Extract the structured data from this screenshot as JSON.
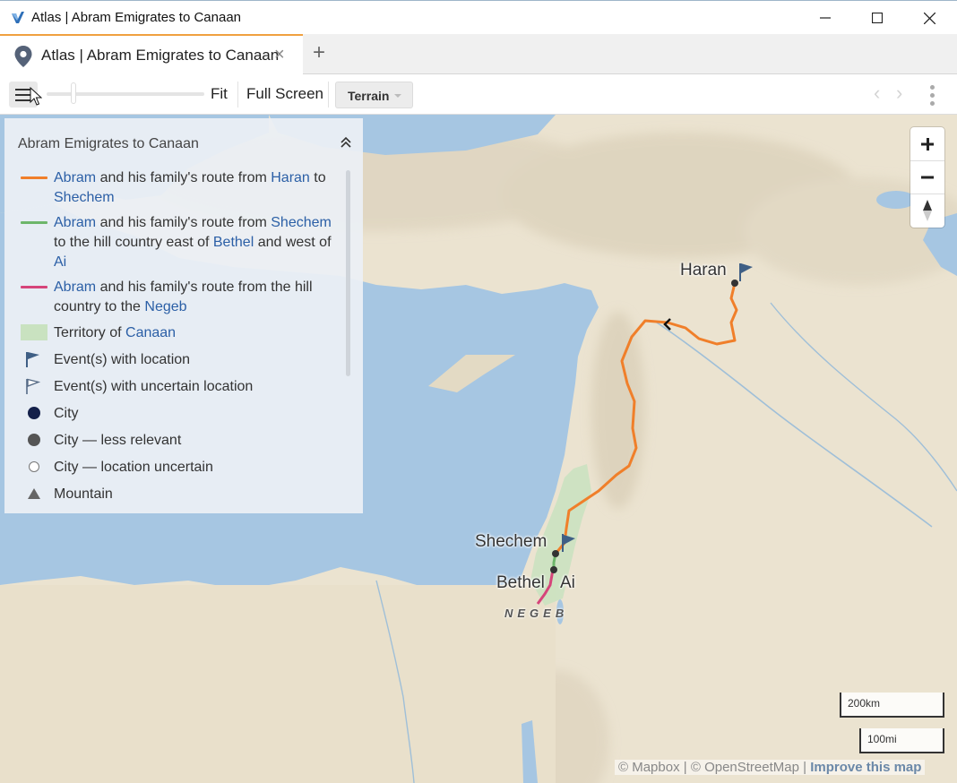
{
  "window": {
    "title": "Atlas | Abram Emigrates to Canaan"
  },
  "tabs": [
    {
      "label": "Atlas | Abram Emigrates to Canaan",
      "close_label": "×"
    }
  ],
  "tab_add_label": "+",
  "toolbar": {
    "fit_label": "Fit",
    "fullscreen_label": "Full Screen",
    "layer_label": "Terrain",
    "back_glyph": "‹",
    "forward_glyph": "›"
  },
  "legend": {
    "title": "Abram Emigrates to Canaan",
    "items": [
      {
        "kind": "line",
        "color": "#f07f2a",
        "parts": [
          "Abram",
          " and his family's route from ",
          "Haran",
          " to ",
          "Shechem"
        ]
      },
      {
        "kind": "line",
        "color": "#6db66a",
        "parts": [
          "Abram",
          " and his family's route from ",
          "Shechem",
          " to the hill country east of ",
          "Bethel",
          " and west of ",
          "Ai"
        ]
      },
      {
        "kind": "line",
        "color": "#d6457a",
        "parts": [
          "Abram",
          " and his family's route from the hill country to the ",
          "Negeb"
        ]
      },
      {
        "kind": "area",
        "color": "#c9e2c0",
        "parts": [
          "Territory of ",
          "Canaan"
        ]
      },
      {
        "kind": "flag",
        "label": "Event(s) with location",
        "icon": "flag-icon"
      },
      {
        "kind": "flag-outline",
        "label": "Event(s) with uncertain location",
        "icon": "flag-outline-icon"
      },
      {
        "kind": "city",
        "label": "City",
        "color": "#14204a"
      },
      {
        "kind": "city-less",
        "label": "City — less relevant",
        "color": "#555555"
      },
      {
        "kind": "city-uncertain",
        "label": "City — location uncertain"
      },
      {
        "kind": "mountain",
        "label": "Mountain",
        "icon": "mountain-icon"
      }
    ]
  },
  "map": {
    "places": [
      {
        "name": "Haran"
      },
      {
        "name": "Shechem"
      },
      {
        "name": "Bethel"
      },
      {
        "name": "Ai"
      }
    ],
    "region": "NEGEB",
    "scale": {
      "km": "200km",
      "mi": "100mi"
    },
    "attribution": {
      "mapbox": "© Mapbox",
      "sep": "|",
      "osm": "© OpenStreetMap",
      "improve": "Improve this map"
    },
    "colors": {
      "sea": "#a6c6e2",
      "land": "#ece4d2",
      "route_haran_shechem": "#f07f2a",
      "route_shechem_bethel": "#6db66a",
      "route_negeb": "#d6457a",
      "canaan": "#c9e2c0",
      "flag": "#3f5f85"
    }
  }
}
